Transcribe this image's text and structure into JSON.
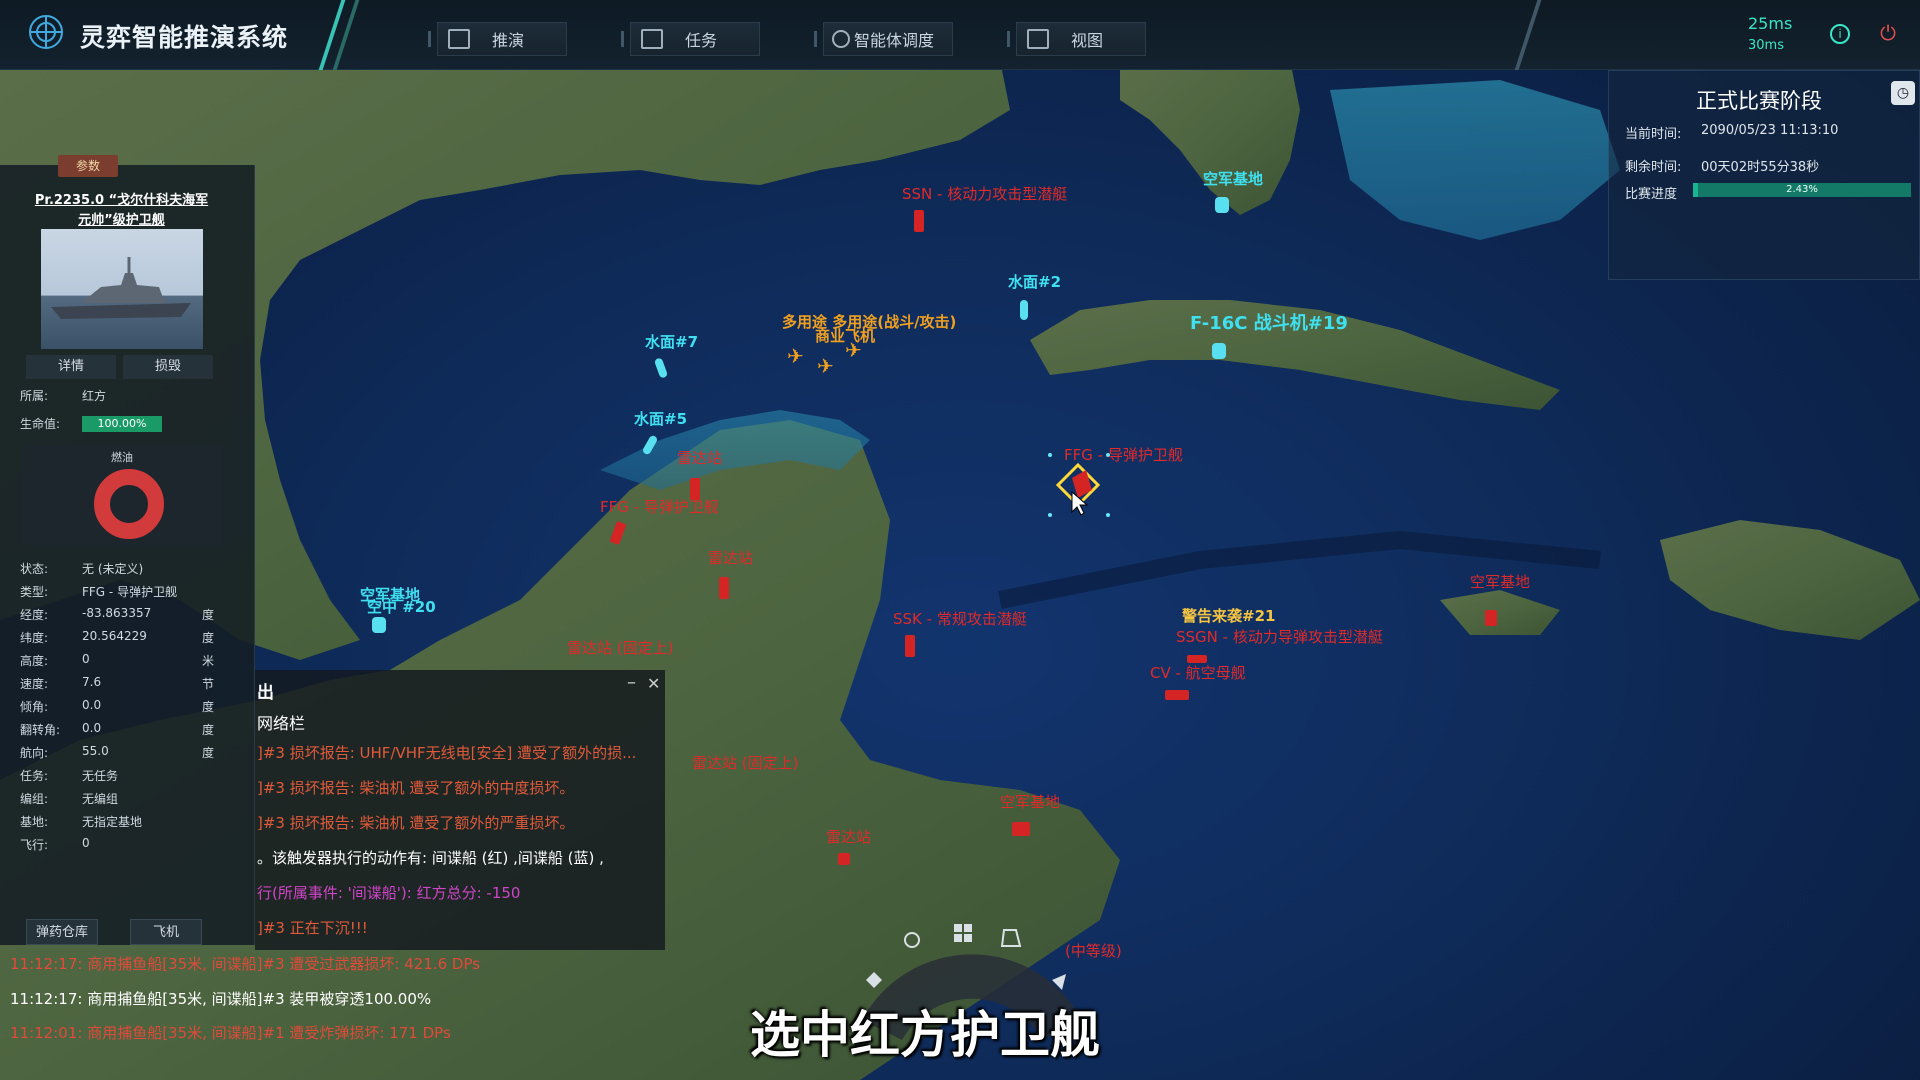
{
  "app": {
    "title": "灵弈智能推演系统"
  },
  "nav": [
    {
      "label": "推演",
      "icon": "play-icon"
    },
    {
      "label": "任务",
      "icon": "list-icon"
    },
    {
      "label": "智能体调度",
      "icon": "agents-icon"
    },
    {
      "label": "视图",
      "icon": "image-icon"
    }
  ],
  "ping": {
    "primary": "25ms",
    "secondary": "30ms"
  },
  "status": {
    "title": "正式比赛阶段",
    "current_time_label": "当前时间",
    "current_time": "2090/05/23 11:13:10",
    "remaining_label": "剩余时间",
    "remaining": "00天02时55分38秒",
    "progress_label": "比赛进度",
    "progress_text": "2.43%",
    "progress_value": 0.0243
  },
  "left_panel": {
    "tab": "参数",
    "ship_name": "Pr.2235.0 “戈尔什科夫海军元帅”级护卫舰",
    "details_btn": "详情",
    "damage_btn": "损毁",
    "fuel_label": "燃油",
    "hp_label": "生命值:",
    "hp_value": "100.00%",
    "hp_fraction": 1.0,
    "fields": [
      {
        "k": "所属:",
        "v": "红方",
        "u": ""
      },
      {
        "k": "状态:",
        "v": "无 (未定义)",
        "u": ""
      },
      {
        "k": "类型:",
        "v": "FFG - 导弹护卫舰",
        "u": ""
      },
      {
        "k": "经度:",
        "v": "-83.863357",
        "u": "度"
      },
      {
        "k": "纬度:",
        "v": "20.564229",
        "u": "度"
      },
      {
        "k": "高度:",
        "v": "0",
        "u": "米"
      },
      {
        "k": "速度:",
        "v": "7.6",
        "u": "节"
      },
      {
        "k": "倾角:",
        "v": "0.0",
        "u": "度"
      },
      {
        "k": "翻转角:",
        "v": "0.0",
        "u": "度"
      },
      {
        "k": "航向:",
        "v": "55.0",
        "u": "度"
      },
      {
        "k": "任务:",
        "v": "无任务",
        "u": ""
      },
      {
        "k": "编组:",
        "v": "无编组",
        "u": ""
      },
      {
        "k": "基地:",
        "v": "无指定基地",
        "u": ""
      },
      {
        "k": "飞行:",
        "v": "0",
        "u": ""
      }
    ],
    "ammo_btn": "弹药仓库",
    "aircraft_btn": "飞机"
  },
  "console": {
    "title": "出",
    "subtitle": "网络栏",
    "lines": [
      {
        "text": "]#3 损坏报告: UHF/VHF无线电[安全] 遭受了额外的损...",
        "color": "#e05a3a"
      },
      {
        "text": "]#3 损坏报告: 柴油机 遭受了额外的中度损坏。",
        "color": "#e05a3a"
      },
      {
        "text": "]#3 损坏报告: 柴油机 遭受了额外的严重损坏。",
        "color": "#e05a3a"
      },
      {
        "text": "。该触发器执行的动作有: 间谍船 (红) ,间谍船 (蓝) ,",
        "color": "#ffffff"
      },
      {
        "text": "行(所属事件: '间谍船'): 红方总分: -150",
        "color": "#d044c8"
      },
      {
        "text": "]#3 正在下沉!!!",
        "color": "#e05a3a"
      }
    ]
  },
  "log": [
    {
      "text": "11:12:17: 商用捕鱼船[35米, 间谍船]#3 遭受过武器损坏: 421.6 DPs",
      "color": "#e04a3a"
    },
    {
      "text": "11:12:17: 商用捕鱼船[35米, 间谍船]#3 装甲被穿透100.00%",
      "color": "#ffffff"
    },
    {
      "text": "11:12:01: 商用捕鱼船[35米, 间谍船]#1 遭受炸弹损坏: 171 DPs",
      "color": "#e04a3a"
    }
  ],
  "map_labels": [
    {
      "text": "SSN - 核动力攻击型潜艇",
      "kind": "red"
    },
    {
      "text": "空军基地",
      "kind": "cyan"
    },
    {
      "text": "水面#2",
      "kind": "cyan"
    },
    {
      "text": "多用途 多用途(战斗/攻击)",
      "kind": "orange"
    },
    {
      "text": "商业飞机",
      "kind": "orange"
    },
    {
      "text": "水面#7",
      "kind": "cyan"
    },
    {
      "text": "F-16C 战斗机#19",
      "kind": "cyan"
    },
    {
      "text": "水面#5",
      "kind": "cyan"
    },
    {
      "text": "FFG - 导弹护卫舰",
      "kind": "red"
    },
    {
      "text": "FFG - 导弹护卫舰",
      "kind": "red"
    },
    {
      "text": "雷达站",
      "kind": "red"
    },
    {
      "text": "雷达站",
      "kind": "red"
    },
    {
      "text": "空军基地",
      "kind": "cyan"
    },
    {
      "text": "空中 #20",
      "kind": "cyan"
    },
    {
      "text": "SSK - 常规攻击潜艇",
      "kind": "red"
    },
    {
      "text": "警告来袭#21",
      "kind": "yellow"
    },
    {
      "text": "SSGN - 核动力导弹攻击型潜艇",
      "kind": "red"
    },
    {
      "text": "CV - 航空母舰",
      "kind": "red"
    },
    {
      "text": "空军基地",
      "kind": "red"
    },
    {
      "text": "雷达站 (固定上)",
      "kind": "red"
    },
    {
      "text": "雷达站 (固定上)",
      "kind": "red"
    },
    {
      "text": "空军基地",
      "kind": "red"
    },
    {
      "text": "雷达站",
      "kind": "red"
    },
    {
      "text": "(中等级)",
      "kind": "red"
    }
  ],
  "subtitle": "选中红方护卫舰"
}
